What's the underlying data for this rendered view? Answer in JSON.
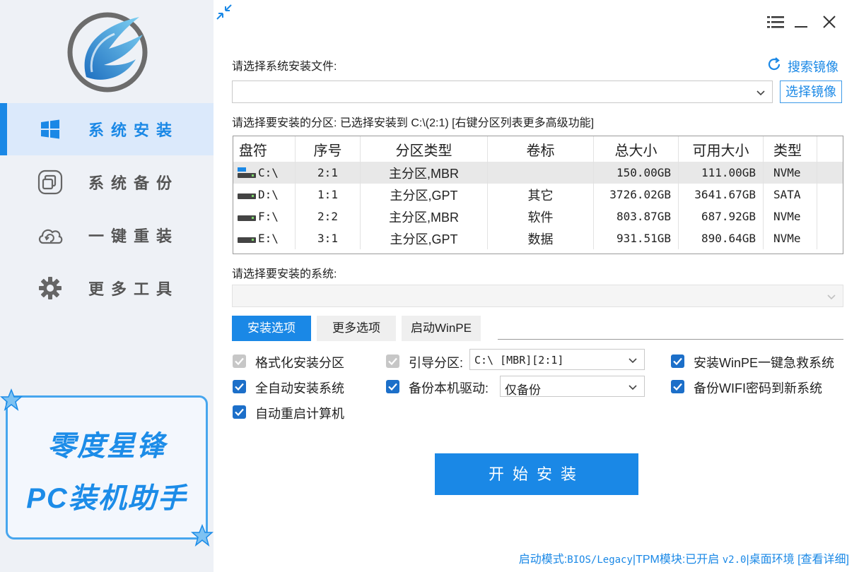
{
  "sidebar": {
    "nav": [
      {
        "label": "系统安装",
        "icon": "windows-icon",
        "active": true
      },
      {
        "label": "系统备份",
        "icon": "backup-icon",
        "active": false
      },
      {
        "label": "一键重装",
        "icon": "cloud-refresh-icon",
        "active": false
      },
      {
        "label": "更多工具",
        "icon": "gear-icon",
        "active": false
      }
    ],
    "promo": {
      "line1": "零度星锋",
      "line2": "PC装机助手"
    }
  },
  "main": {
    "image_label": "请选择系统安装文件:",
    "search_image": "搜索镜像",
    "pick_image": "选择镜像",
    "image_value": "",
    "partition_label": "请选择要安装的分区: 已选择安装到 C:\\(2:1) [右键分区列表更多高级功能]",
    "table": {
      "columns": [
        "盘符",
        "序号",
        "分区类型",
        "卷标",
        "总大小",
        "可用大小",
        "类型"
      ],
      "rows": [
        [
          "C:\\",
          "2:1",
          "主分区,MBR",
          "",
          "150.00GB",
          "111.00GB",
          "NVMe"
        ],
        [
          "D:\\",
          "1:1",
          "主分区,GPT",
          "其它",
          "3726.02GB",
          "3641.67GB",
          "SATA"
        ],
        [
          "F:\\",
          "2:2",
          "主分区,MBR",
          "软件",
          "803.87GB",
          "687.92GB",
          "NVMe"
        ],
        [
          "E:\\",
          "3:1",
          "主分区,GPT",
          "数据",
          "931.51GB",
          "890.64GB",
          "NVMe"
        ]
      ],
      "selected_row": 0
    },
    "system_label": "请选择要安装的系统:",
    "tabs": [
      "安装选项",
      "更多选项",
      "启动WinPE"
    ],
    "options": {
      "format": {
        "label": "格式化安装分区",
        "checked": true,
        "disabled": true
      },
      "auto_install": {
        "label": "全自动安装系统",
        "checked": true
      },
      "auto_reboot": {
        "label": "自动重启计算机",
        "checked": true
      },
      "boot_partition": {
        "label": "引导分区:",
        "checked": true,
        "disabled": true,
        "value": "C:\\ [MBR][2:1]"
      },
      "backup_driver": {
        "label": "备份本机驱动:",
        "checked": true,
        "value": "仅备份"
      },
      "winpe_rescue": {
        "label": "安装WinPE一键急救系统",
        "checked": true
      },
      "wifi_backup": {
        "label": "备份WIFI密码到新系统",
        "checked": true
      }
    },
    "start_button": "开始安装",
    "status": {
      "boot_mode": "启动模式:",
      "boot_value": "BIOS/Legacy",
      "tpm": "|TPM模块:已开启",
      "version": "v2.0",
      "env": "|桌面环境",
      "details": "[查看详细]"
    }
  },
  "colors": {
    "accent": "#1a88e6",
    "sidebar_bg": "#eef1f6",
    "active_nav_bg": "#dbe9fb",
    "checkbox": "#1c6fc9"
  }
}
